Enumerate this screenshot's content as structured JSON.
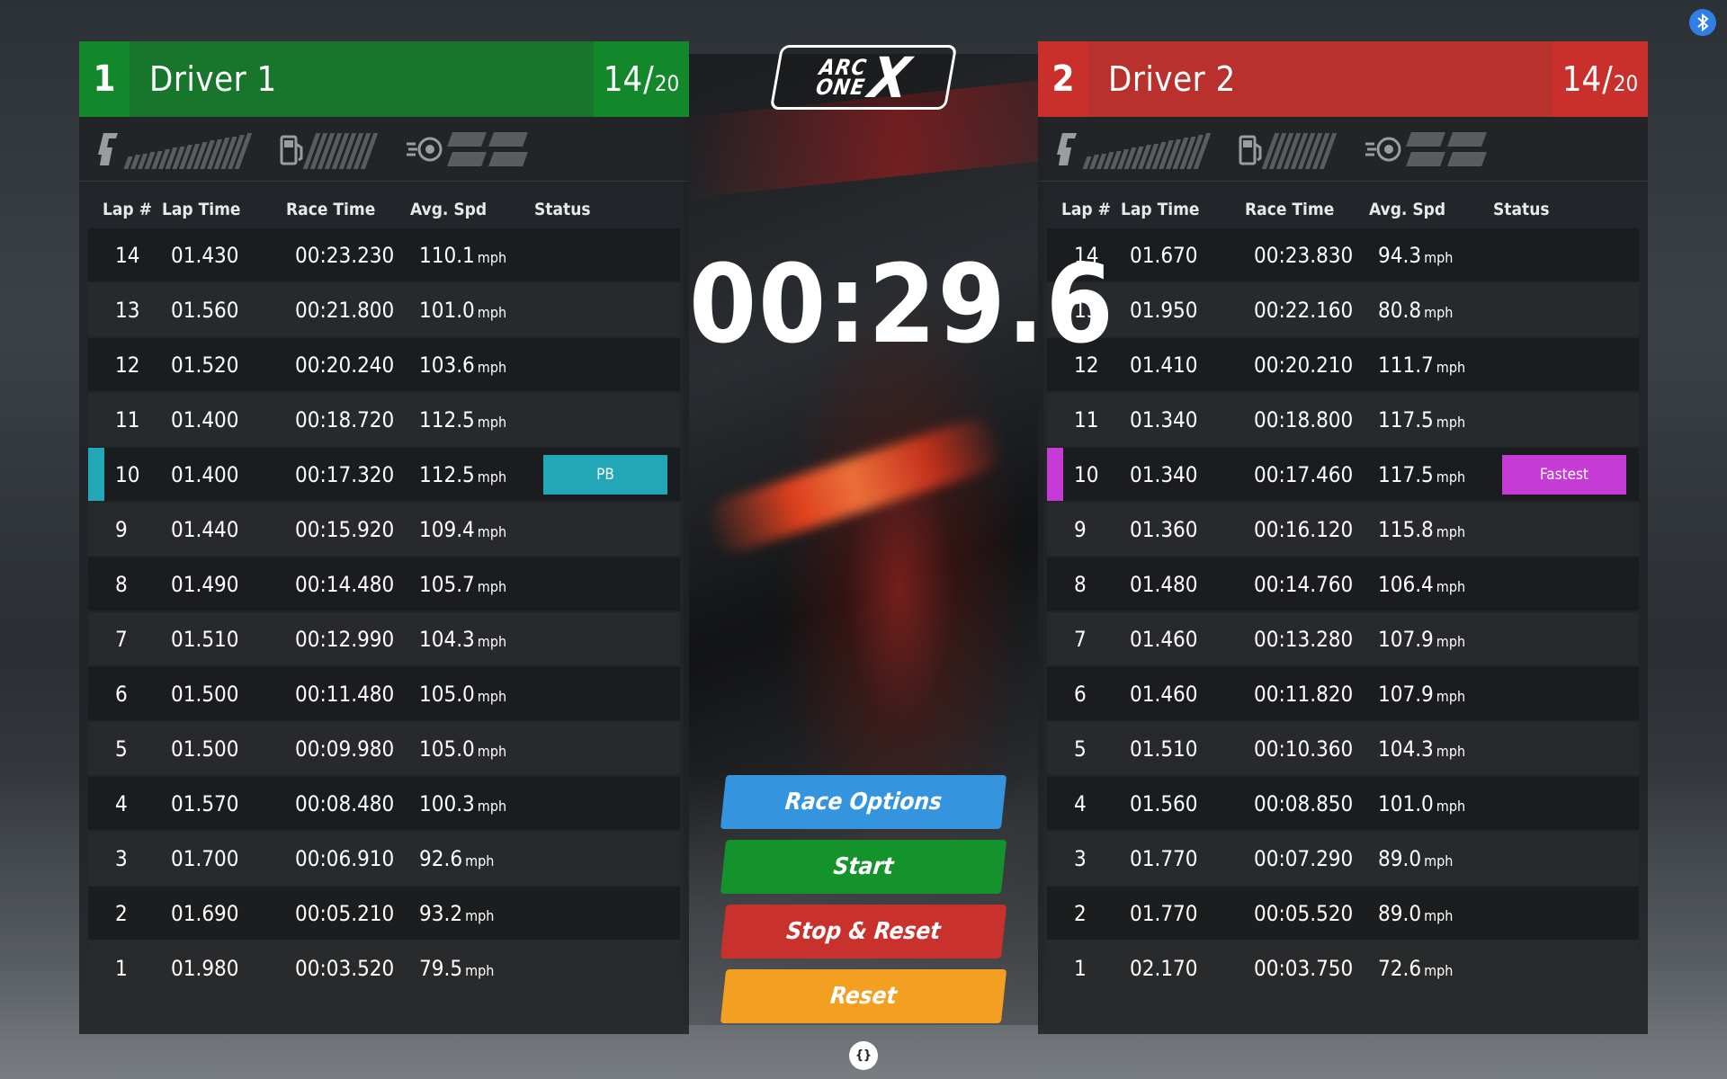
{
  "logo": {
    "line1": "ARC",
    "line2": "ONE",
    "mark": "X"
  },
  "timer": "00:29.6",
  "controls": {
    "race_options": "Race Options",
    "start": "Start",
    "stop_reset": "Stop & Reset",
    "reset": "Reset"
  },
  "debug_icon": "{}",
  "bluetooth_icon": "bluetooth-icon",
  "columns": {
    "lap": "Lap #",
    "lap_time": "Lap Time",
    "race_time": "Race Time",
    "avg_spd": "Avg. Spd",
    "status": "Status"
  },
  "unit": "mph",
  "colors": {
    "driver1": "#12882a",
    "driver2": "#c9302c",
    "pb": "#21a7b5",
    "fastest": "#c63ad6"
  },
  "drivers": [
    {
      "number": "1",
      "name": "Driver 1",
      "lap_current": "14",
      "lap_total": "20",
      "laps": [
        {
          "lap": "14",
          "lap_time": "01.430",
          "race_time": "00:23.230",
          "avg": "110.1",
          "status": ""
        },
        {
          "lap": "13",
          "lap_time": "01.560",
          "race_time": "00:21.800",
          "avg": "101.0",
          "status": ""
        },
        {
          "lap": "12",
          "lap_time": "01.520",
          "race_time": "00:20.240",
          "avg": "103.6",
          "status": ""
        },
        {
          "lap": "11",
          "lap_time": "01.400",
          "race_time": "00:18.720",
          "avg": "112.5",
          "status": ""
        },
        {
          "lap": "10",
          "lap_time": "01.400",
          "race_time": "00:17.320",
          "avg": "112.5",
          "status": "PB"
        },
        {
          "lap": "9",
          "lap_time": "01.440",
          "race_time": "00:15.920",
          "avg": "109.4",
          "status": ""
        },
        {
          "lap": "8",
          "lap_time": "01.490",
          "race_time": "00:14.480",
          "avg": "105.7",
          "status": ""
        },
        {
          "lap": "7",
          "lap_time": "01.510",
          "race_time": "00:12.990",
          "avg": "104.3",
          "status": ""
        },
        {
          "lap": "6",
          "lap_time": "01.500",
          "race_time": "00:11.480",
          "avg": "105.0",
          "status": ""
        },
        {
          "lap": "5",
          "lap_time": "01.500",
          "race_time": "00:09.980",
          "avg": "105.0",
          "status": ""
        },
        {
          "lap": "4",
          "lap_time": "01.570",
          "race_time": "00:08.480",
          "avg": "100.3",
          "status": ""
        },
        {
          "lap": "3",
          "lap_time": "01.700",
          "race_time": "00:06.910",
          "avg": "92.6",
          "status": ""
        },
        {
          "lap": "2",
          "lap_time": "01.690",
          "race_time": "00:05.210",
          "avg": "93.2",
          "status": ""
        },
        {
          "lap": "1",
          "lap_time": "01.980",
          "race_time": "00:03.520",
          "avg": "79.5",
          "status": ""
        }
      ]
    },
    {
      "number": "2",
      "name": "Driver 2",
      "lap_current": "14",
      "lap_total": "20",
      "laps": [
        {
          "lap": "14",
          "lap_time": "01.670",
          "race_time": "00:23.830",
          "avg": "94.3",
          "status": ""
        },
        {
          "lap": "13",
          "lap_time": "01.950",
          "race_time": "00:22.160",
          "avg": "80.8",
          "status": ""
        },
        {
          "lap": "12",
          "lap_time": "01.410",
          "race_time": "00:20.210",
          "avg": "111.7",
          "status": ""
        },
        {
          "lap": "11",
          "lap_time": "01.340",
          "race_time": "00:18.800",
          "avg": "117.5",
          "status": ""
        },
        {
          "lap": "10",
          "lap_time": "01.340",
          "race_time": "00:17.460",
          "avg": "117.5",
          "status": "Fastest"
        },
        {
          "lap": "9",
          "lap_time": "01.360",
          "race_time": "00:16.120",
          "avg": "115.8",
          "status": ""
        },
        {
          "lap": "8",
          "lap_time": "01.480",
          "race_time": "00:14.760",
          "avg": "106.4",
          "status": ""
        },
        {
          "lap": "7",
          "lap_time": "01.460",
          "race_time": "00:13.280",
          "avg": "107.9",
          "status": ""
        },
        {
          "lap": "6",
          "lap_time": "01.460",
          "race_time": "00:11.820",
          "avg": "107.9",
          "status": ""
        },
        {
          "lap": "5",
          "lap_time": "01.510",
          "race_time": "00:10.360",
          "avg": "104.3",
          "status": ""
        },
        {
          "lap": "4",
          "lap_time": "01.560",
          "race_time": "00:08.850",
          "avg": "101.0",
          "status": ""
        },
        {
          "lap": "3",
          "lap_time": "01.770",
          "race_time": "00:07.290",
          "avg": "89.0",
          "status": ""
        },
        {
          "lap": "2",
          "lap_time": "01.770",
          "race_time": "00:05.520",
          "avg": "89.0",
          "status": ""
        },
        {
          "lap": "1",
          "lap_time": "02.170",
          "race_time": "00:03.750",
          "avg": "72.6",
          "status": ""
        }
      ]
    }
  ]
}
